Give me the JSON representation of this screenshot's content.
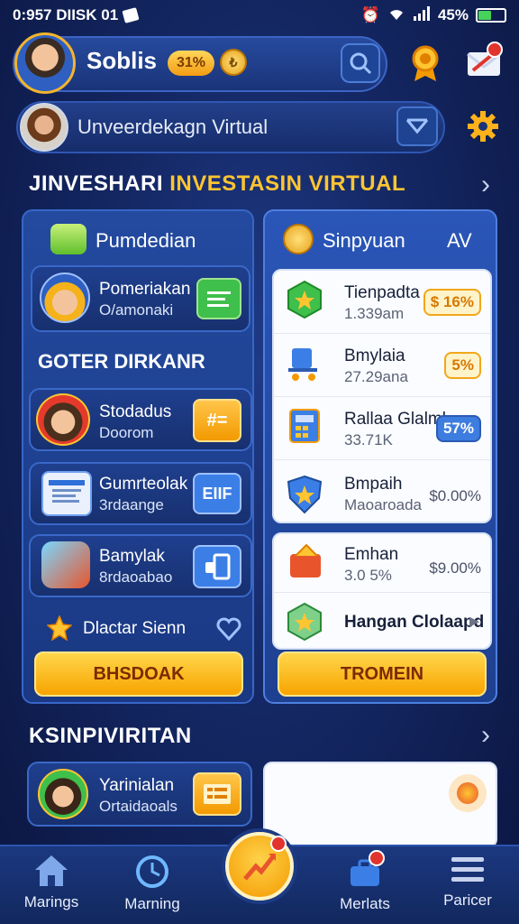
{
  "status_bar": {
    "time": "0:957 DIISK 01",
    "battery": "45%",
    "battery_fraction": 0.45
  },
  "header": {
    "username": "Soblis",
    "percent_badge": "31%",
    "coin_symbol": "₺"
  },
  "sub_header": {
    "label": "Unveerdekagn Virtual"
  },
  "section_title": {
    "part1": "JINVESHARI",
    "part2": "INVESTASIN VIRTUAL"
  },
  "left_panel": {
    "header": "Pumdedian",
    "profile_card": {
      "title": "Pomeriakan",
      "subtitle": "O/amonaki"
    },
    "subsection_title": "GOTER DIRKANR",
    "items": [
      {
        "title": "Stodadus",
        "subtitle": "Doorom",
        "icon_text": "#="
      },
      {
        "title": "Gumrteolak",
        "subtitle": "3rdaange",
        "icon_text": "EIIF"
      },
      {
        "title": "Bamylak",
        "subtitle": "8rdaoabao"
      }
    ],
    "footer_label": "Dlactar Sienn",
    "button": "BHSDOAK"
  },
  "right_panel": {
    "header": "Sinpyuan",
    "header_sort": "AV",
    "rows": [
      {
        "name": "Tienpadta",
        "sub": "1.339am",
        "value": "$ 16%",
        "style": "orange"
      },
      {
        "name": "Bmylaia",
        "sub": "27.29ana",
        "value": "5%",
        "style": "orange"
      },
      {
        "name": "Rallaa Glalml",
        "sub": "33.71K",
        "value": "57%",
        "style": "blue"
      },
      {
        "name": "Bmpaih",
        "sub": "Maoaroada",
        "value": "$0.00%",
        "style": "plain"
      }
    ],
    "rows2": [
      {
        "name": "Emhan",
        "sub": "3.0 5%",
        "value": "$9.00%"
      },
      {
        "name": "Hangan Clolaapd",
        "sub": "",
        "value": ""
      }
    ],
    "button": "TROMEIN"
  },
  "section2_title": "KSINPIVIRITAN",
  "bottom_left_card": {
    "title": "Yarinialan",
    "subtitle": "Ortaidaoals"
  },
  "bottom_nav": {
    "items": [
      {
        "label": "Marings",
        "icon": "home-icon"
      },
      {
        "label": "Marning",
        "icon": "clock-icon"
      },
      {
        "label": "Merlats",
        "icon": "briefcase-icon"
      },
      {
        "label": "Paricer",
        "icon": "menu-icon"
      }
    ]
  },
  "colors": {
    "accent": "#ffc531",
    "panel": "#234a9f",
    "button": "#f7a400"
  }
}
